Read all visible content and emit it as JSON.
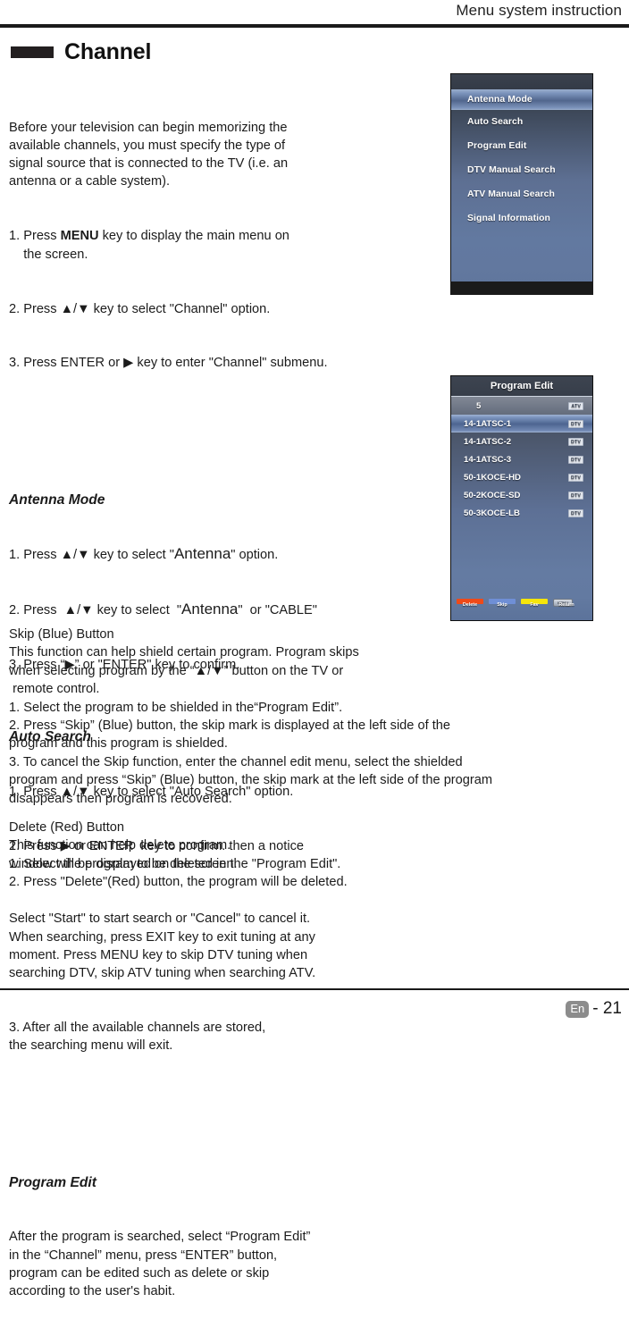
{
  "header": {
    "title": "Menu system instruction"
  },
  "section": {
    "title": "Channel"
  },
  "intro": {
    "paragraph": "Before your television can begin memorizing the\navailable channels, you must specify the type of\nsignal source that is connected to the TV (i.e. an\nantenna or a cable system).",
    "step1_pre": "1. Press ",
    "step1_key": "MENU",
    "step1_post": " key to display the main menu on\n    the screen.",
    "step2": "2. Press ▲/▼ key to select \"Channel\" option.",
    "step3": "3. Press ENTER or ▶ key to enter \"Channel\" submenu."
  },
  "antenna_mode_section": {
    "heading": "Antenna Mode",
    "step1_a": "1. Press ▲/▼ key to select \"",
    "step1_b": "Antenna",
    "step1_c": "\" option.",
    "step2_a": "2. Press  ▲/▼ key to select  \"",
    "step2_b": "Antenna",
    "step2_c": "\"  or \"CABLE\"",
    "step3": "3. Press “▶” or \"ENTER\" key to confirm."
  },
  "auto_search_section": {
    "heading": "Auto Search",
    "step1": "1. Press ▲/▼ key to select \"Auto Search\" option.",
    "step2": "2. Press ▶ or ENTER  key to confirm. then a notice\nwindow will be displayed on the screen.",
    "body": "Select \"Start\" to start search or \"Cancel\" to cancel it.\nWhen searching, press EXIT key to exit tuning at any\nmoment. Press MENU key to skip DTV tuning when\nsearching DTV, skip ATV tuning when searching ATV.",
    "step3": "3. After all the available channels are stored,\nthe searching menu will exit."
  },
  "program_edit_section": {
    "heading": "Program Edit",
    "body": "After the program is searched, select “Program Edit”\nin the “Channel” menu, press “ENTER” button,\nprogram can be edited such as delete or skip\naccording to the user's habit."
  },
  "skip_section": {
    "heading": "Skip (Blue) Button",
    "body": "This function can help shield certain program. Program skips\nwhen selecting program by the “▲/▼” button on the TV or\n remote control.\n1. Select the program to be shielded in the“Program Edit”.\n2. Press “Skip” (Blue) button, the skip mark is displayed at the left side of the\nprogram and this program is shielded.\n3. To cancel the Skip function, enter the channel edit menu, select the shielded\nprogram and press “Skip” (Blue) button, the skip mark at the left side of the program\ndisappears then program is recovered."
  },
  "delete_section": {
    "heading": "Delete (Red) Button",
    "body": "This function can help delete program.\n1. Select the program to be deleted in the \"Program Edit\".\n2. Press \"Delete\"(Red) button, the program will be deleted."
  },
  "osd_antenna": {
    "items": [
      {
        "label": "Antenna Mode",
        "selected": true
      },
      {
        "label": "Auto Search",
        "selected": false
      },
      {
        "label": "Program Edit",
        "selected": false
      },
      {
        "label": "DTV Manual Search",
        "selected": false
      },
      {
        "label": "ATV Manual Search",
        "selected": false
      },
      {
        "label": "Signal Information",
        "selected": false
      }
    ]
  },
  "osd_program_edit": {
    "title": "Program Edit",
    "rows": [
      {
        "name": "5",
        "badge": "ATV",
        "selected": false
      },
      {
        "name": "14-1ATSC-1",
        "badge": "DTV",
        "selected": true
      },
      {
        "name": "14-1ATSC-2",
        "badge": "DTV",
        "selected": false
      },
      {
        "name": "14-1ATSC-3",
        "badge": "DTV",
        "selected": false
      },
      {
        "name": "50-1KOCE-HD",
        "badge": "DTV",
        "selected": false
      },
      {
        "name": "50-2KOCE-SD",
        "badge": "DTV",
        "selected": false
      },
      {
        "name": "50-3KOCE-LB",
        "badge": "DTV",
        "selected": false
      }
    ],
    "buttons": [
      {
        "label": "Delete",
        "color": "#ef4a19"
      },
      {
        "label": "Skip",
        "color": "#6f8fd6"
      },
      {
        "label": "Fav",
        "color": "#f5e50a"
      },
      {
        "label": "Return",
        "color": "#b9c0cc"
      }
    ],
    "return_icon_label": "MENU"
  },
  "footer": {
    "language": "En",
    "page": "- 21"
  }
}
